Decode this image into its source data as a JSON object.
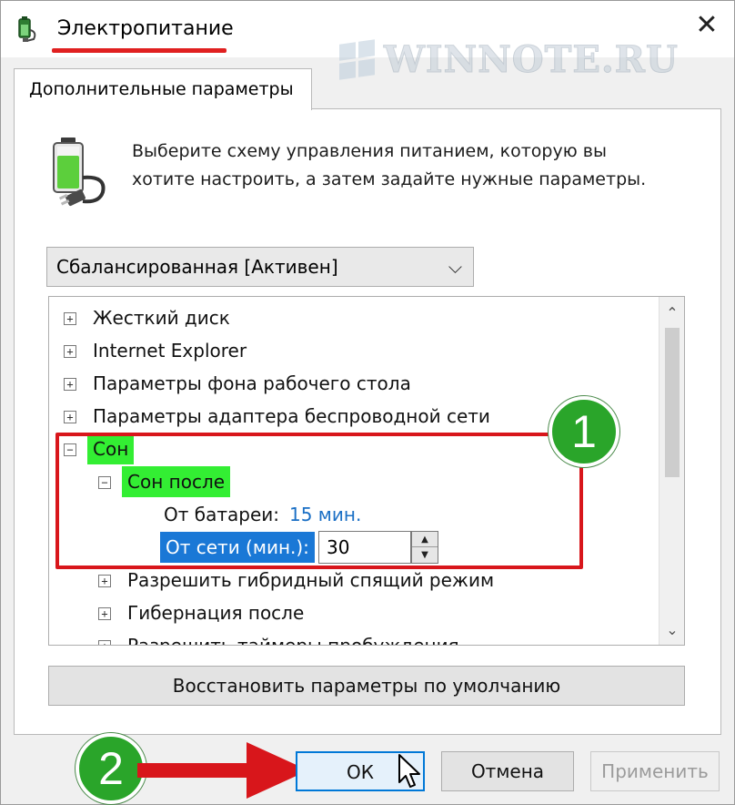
{
  "window": {
    "title": "Электропитание",
    "close_glyph": "✕",
    "watermark": "WINNOTE.RU"
  },
  "tab": {
    "label": "Дополнительные параметры"
  },
  "description": {
    "line1": "Выберите схему управления питанием, которую вы",
    "line2": "хотите настроить, а затем задайте нужные параметры."
  },
  "scheme_select": {
    "value": "Сбалансированная [Активен]",
    "chevron": "⌵"
  },
  "tree": {
    "items": [
      {
        "label": "Жесткий диск",
        "expander": "+"
      },
      {
        "label": "Internet Explorer",
        "expander": "+"
      },
      {
        "label": "Параметры фона рабочего стола",
        "expander": "+"
      },
      {
        "label": "Параметры адаптера беспроводной сети",
        "expander": "+"
      },
      {
        "label": "Сон",
        "expander": "−"
      },
      {
        "label": "Сон после",
        "expander": "−"
      },
      {
        "label": "От батареи:",
        "value": "15 мин."
      },
      {
        "label": "От сети (мин.):",
        "value": "30"
      },
      {
        "label": "Разрешить гибридный спящий режим",
        "expander": "+"
      },
      {
        "label": "Гибернация после",
        "expander": "+"
      },
      {
        "label": "Разрешить таймеры пробуждения",
        "expander": "+"
      }
    ],
    "scroll_up": "⌃",
    "scroll_down": "⌄"
  },
  "annotations": {
    "badge1": "1",
    "badge2": "2"
  },
  "buttons": {
    "restore": "Восстановить параметры по умолчанию",
    "ok": "ОК",
    "cancel": "Отмена",
    "apply": "Применить"
  },
  "colors": {
    "highlight_green": "#33ee33",
    "selection_blue": "#1a78d6",
    "annotation_red": "#d8161b",
    "badge_green": "#2aa52a"
  }
}
